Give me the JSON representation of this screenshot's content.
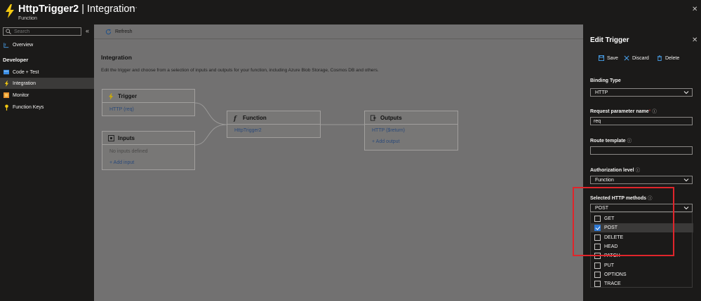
{
  "header": {
    "title_bold": "HttpTrigger2",
    "title_rest": " | Integration",
    "subtitle": "Function",
    "more": "···",
    "close": "✕"
  },
  "sidebar": {
    "search_placeholder": "Search",
    "collapse": "«",
    "overview": "Overview",
    "section": "Developer",
    "items": [
      {
        "label": "Code + Test"
      },
      {
        "label": "Integration"
      },
      {
        "label": "Monitor"
      },
      {
        "label": "Function Keys"
      }
    ]
  },
  "main": {
    "refresh": "Refresh",
    "title": "Integration",
    "description": "Edit the trigger and choose from a selection of inputs and outputs for your function, including Azure Blob Storage, Cosmos DB and others.",
    "trigger": {
      "title": "Trigger",
      "link": "HTTP (req)"
    },
    "inputs": {
      "title": "Inputs",
      "empty": "No inputs defined",
      "add": "+ Add input"
    },
    "function": {
      "title": "Function",
      "link": "HttpTrigger2"
    },
    "outputs": {
      "title": "Outputs",
      "link": "HTTP ($return)",
      "add": "+ Add output"
    }
  },
  "panel": {
    "title": "Edit Trigger",
    "close": "✕",
    "save": "Save",
    "discard": "Discard",
    "delete": "Delete",
    "binding_type_label": "Binding Type",
    "binding_type_value": "HTTP",
    "param_label": "Request parameter name",
    "param_required": "*",
    "param_value": "req",
    "route_label": "Route template",
    "route_value": "",
    "auth_label": "Authorization level",
    "auth_value": "Function",
    "methods_label": "Selected HTTP methods",
    "methods_value": "POST",
    "info": "ⓘ",
    "methods": [
      {
        "label": "GET",
        "checked": false
      },
      {
        "label": "POST",
        "checked": true
      },
      {
        "label": "DELETE",
        "checked": false
      },
      {
        "label": "HEAD",
        "checked": false
      },
      {
        "label": "PATCH",
        "checked": false
      },
      {
        "label": "PUT",
        "checked": false
      },
      {
        "label": "OPTIONS",
        "checked": false
      },
      {
        "label": "TRACE",
        "checked": false
      }
    ]
  },
  "colors": {
    "accent": "#2f7ad6",
    "highlight": "#e0252b",
    "bolt": "#f2c811"
  }
}
